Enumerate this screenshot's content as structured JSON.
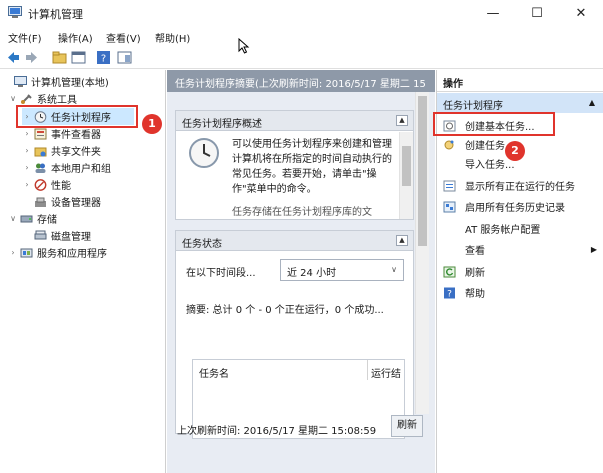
{
  "window": {
    "title": "计算机管理",
    "controls": {
      "minimize": "—",
      "maximize": "☐",
      "close": "✕"
    }
  },
  "menu": [
    "文件(F)",
    "操作(A)",
    "查看(V)",
    "帮助(H)"
  ],
  "tree": {
    "items": [
      {
        "label": "计算机管理(本地)",
        "twisty": ""
      },
      {
        "label": "系统工具",
        "twisty": "∨"
      },
      {
        "label": "任务计划程序",
        "twisty": "›"
      },
      {
        "label": "事件查看器",
        "twisty": "›"
      },
      {
        "label": "共享文件夹",
        "twisty": "›"
      },
      {
        "label": "本地用户和组",
        "twisty": "›"
      },
      {
        "label": "性能",
        "twisty": "›"
      },
      {
        "label": "设备管理器",
        "twisty": ""
      },
      {
        "label": "存储",
        "twisty": "∨"
      },
      {
        "label": "磁盘管理",
        "twisty": ""
      },
      {
        "label": "服务和应用程序",
        "twisty": "›"
      }
    ]
  },
  "middle": {
    "header": "任务计划程序摘要(上次刷新时间: 2016/5/17 星期二 15",
    "overview": {
      "title": "任务计划程序概述",
      "text1": "可以使用任务计划程序来创建和管理计算机将在所指定的时间自动执行的常见任务。若要开始，请单击\"操作\"菜单中的命令。",
      "text2": "任务存储在任务计划程序库的文"
    },
    "status": {
      "title": "任务状态",
      "period_label": "在以下时间段...",
      "period_value": "近 24 小时",
      "summary": "摘要: 总计 0 个 - 0 个正在运行，0 个成功...",
      "col_name": "任务名",
      "col_result": "运行结"
    },
    "last_refresh": "上次刷新时间: 2016/5/17 星期二 15:08:59",
    "refresh_button": "刷新"
  },
  "actions": {
    "header": "操作",
    "section": "任务计划程序",
    "items": [
      {
        "label": "创建基本任务..."
      },
      {
        "label": "创建任务..."
      },
      {
        "label": "导入任务..."
      },
      {
        "label": "显示所有正在运行的任务"
      },
      {
        "label": "启用所有任务历史记录"
      },
      {
        "label": "AT 服务帐户配置"
      },
      {
        "label": "查看"
      },
      {
        "label": "刷新"
      },
      {
        "label": "帮助"
      }
    ]
  },
  "annotations": {
    "step1": "1",
    "step2": "2"
  },
  "colors": {
    "accent": "#e0342c",
    "selected": "#cce8ff",
    "section": "#d2e4f8",
    "header": "#8e99a8"
  }
}
